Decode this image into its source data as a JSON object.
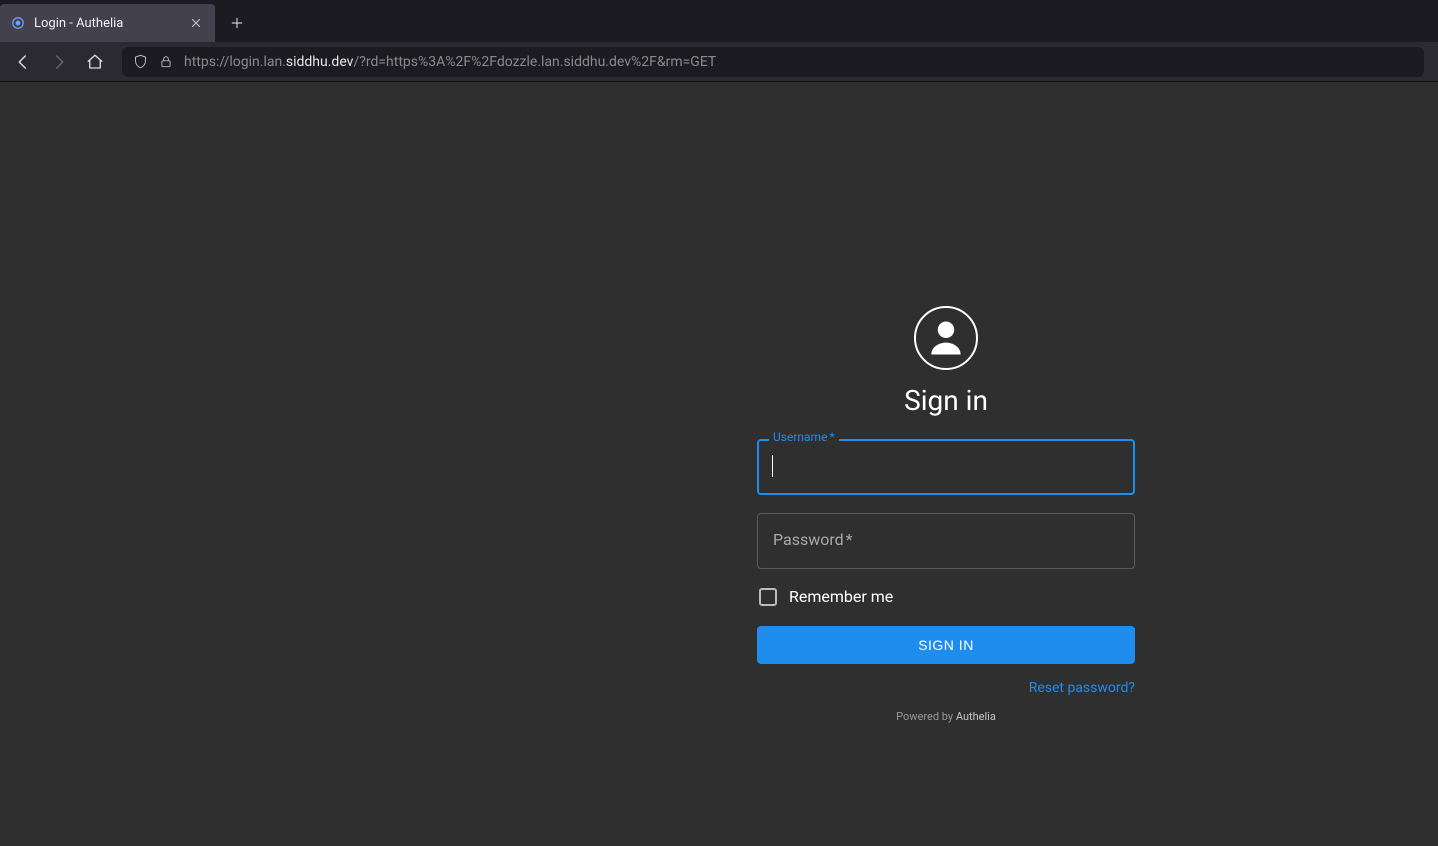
{
  "browser": {
    "tab_title": "Login - Authelia",
    "url_prefix": "https://login.lan.",
    "url_domain": "siddhu.dev",
    "url_suffix": "/?rd=https%3A%2F%2Fdozzle.lan.siddhu.dev%2F&rm=GET"
  },
  "login": {
    "title": "Sign in",
    "username_label": "Username",
    "username_required": "*",
    "password_label": "Password",
    "password_required": "*",
    "remember_label": "Remember me",
    "signin_button": "SIGN IN",
    "reset_link": "Reset password?",
    "powered_prefix": "Powered by ",
    "powered_brand": "Authelia"
  }
}
